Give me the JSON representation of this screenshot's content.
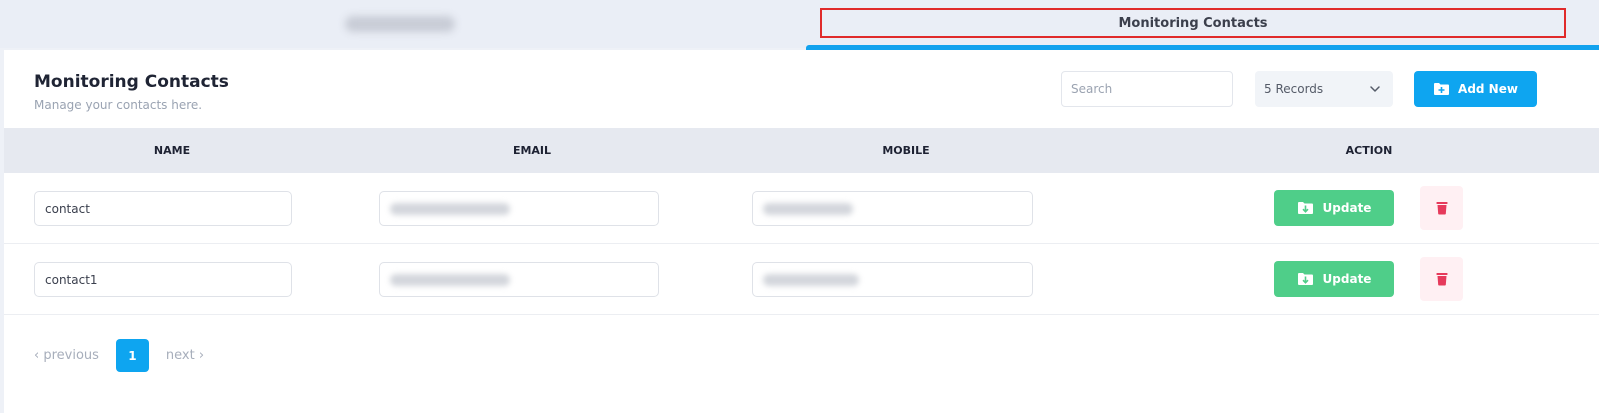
{
  "tabs": [
    {
      "label": ""
    },
    {
      "label": "Monitoring Contacts",
      "active": true
    }
  ],
  "header": {
    "title": "Monitoring Contacts",
    "subtitle": "Manage your contacts here."
  },
  "toolbar": {
    "search_placeholder": "Search",
    "search_value": "",
    "records_label": "5 Records",
    "add_label": "Add New"
  },
  "table": {
    "columns": [
      "NAME",
      "EMAIL",
      "MOBILE",
      "ACTION"
    ],
    "rows": [
      {
        "name": "contact",
        "email": "",
        "mobile": "",
        "update_label": "Update"
      },
      {
        "name": "contact1",
        "email": "",
        "mobile": "",
        "update_label": "Update"
      }
    ]
  },
  "pagination": {
    "previous": "‹ previous",
    "current": "1",
    "next": "next ›"
  },
  "colors": {
    "accent": "#0ea5f0",
    "update": "#4fce89",
    "delete": "#e63a5b",
    "highlight_border": "#e02a2a"
  },
  "icons": {
    "add": "folder-plus-icon",
    "update": "folder-download-icon",
    "delete": "trash-icon",
    "dropdown": "chevron-down-icon"
  }
}
